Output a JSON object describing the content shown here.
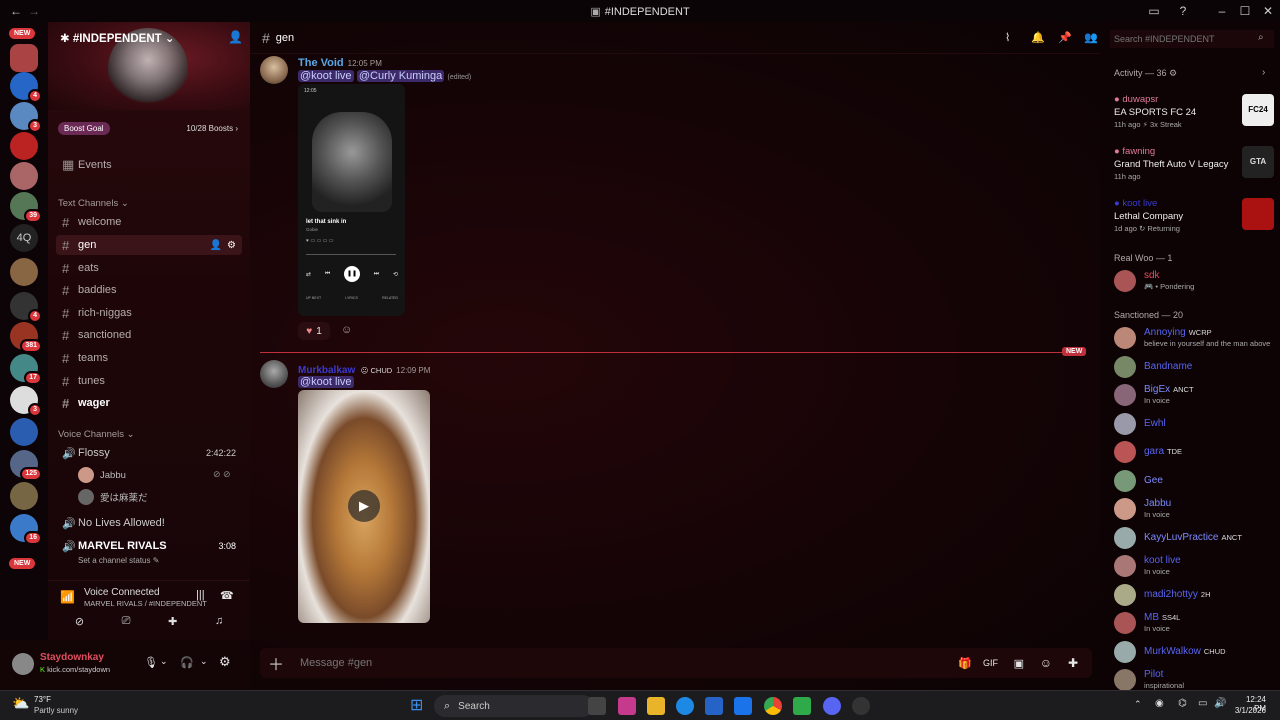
{
  "window": {
    "title": "#INDEPENDENT"
  },
  "guild_badges": [
    "NEW",
    "4",
    "3",
    "39",
    "4",
    "381",
    "17",
    "3",
    "125",
    "16",
    "NEW"
  ],
  "guild_text": "4Q",
  "server": {
    "name": "#INDEPENDENT",
    "boost_label": "Boost Goal",
    "boost_progress": "10/28 Boosts",
    "events": "Events",
    "text_category": "Text Channels",
    "channels": [
      "welcome",
      "gen",
      "eats",
      "baddies",
      "rich-niggas",
      "sanctioned",
      "teams",
      "tunes",
      "wager"
    ],
    "voice_category": "Voice Channels",
    "voice": {
      "flossy": "Flossy",
      "flossy_time": "2:42:22",
      "user1": "Jabbu",
      "user2": "愛は麻薬だ",
      "nolives": "No Lives Allowed!",
      "marvel": "MARVEL RIVALS",
      "marvel_time": "3:08",
      "marvel_status": "Set a channel status"
    }
  },
  "voicebar": {
    "status": "Voice Connected",
    "location": "MARVEL RIVALS / #INDEPENDENT"
  },
  "user": {
    "name": "Staydownkay",
    "status": "kick.com/staydown"
  },
  "channel": {
    "name": "gen"
  },
  "search": {
    "placeholder": "Search #INDEPENDENT"
  },
  "messages": [
    {
      "author": "The Void",
      "time": "12:05 PM",
      "mention1": "@koot live",
      "mention2": "@Curly Kuminga",
      "edited": "(edited)",
      "phone_song": "let that sink in",
      "phone_artist": "Gobie",
      "phone_time": "12:05",
      "phone_tabs": [
        "UP NEXT",
        "LYRICS",
        "RELATED"
      ],
      "reaction_count": "1"
    },
    {
      "author": "Murkbalkaw",
      "tag": "CHUD",
      "time": "12:09 PM",
      "mention": "@koot live"
    }
  ],
  "new_label": "NEW",
  "composer": {
    "placeholder": "Message #gen"
  },
  "activity": {
    "header": "Activity — 36",
    "items": [
      {
        "name": "duwapsr",
        "game": "EA SPORTS FC 24",
        "meta": "11h ago  ⚡ 3x Streak",
        "thumb": "FC24"
      },
      {
        "name": "fawning",
        "game": "Grand Theft Auto V Legacy",
        "meta": "11h ago",
        "thumb": "GTA"
      },
      {
        "name": "koot live",
        "game": "Lethal Company",
        "meta": "1d ago  ↻ Returning",
        "thumb": ""
      }
    ]
  },
  "sections": {
    "real": "Real Woo — 1",
    "sanctioned": "Sanctioned — 20"
  },
  "real_members": [
    {
      "name": "sdk",
      "sub": "Pondering",
      "color": "#e0505a"
    }
  ],
  "sanctioned_members": [
    {
      "name": "Annoying",
      "tag": "WCRP",
      "sub": "believe in yourself and the man above",
      "color": "#5865f2"
    },
    {
      "name": "Bandname",
      "tag": "",
      "sub": "",
      "color": "#5865f2"
    },
    {
      "name": "BigEx",
      "tag": "ANCT",
      "sub": "In voice",
      "color": "#7c8aff"
    },
    {
      "name": "Ewhl",
      "tag": "",
      "sub": "",
      "color": "#5865f2"
    },
    {
      "name": "gara",
      "tag": "TDE",
      "sub": "",
      "color": "#5865f2"
    },
    {
      "name": "Gee",
      "tag": "",
      "sub": "",
      "color": "#7c8aff"
    },
    {
      "name": "Jabbu",
      "tag": "",
      "sub": "In voice",
      "color": "#7c8aff"
    },
    {
      "name": "KayyLuvPractice",
      "tag": "ANCT",
      "sub": "",
      "color": "#7c8aff"
    },
    {
      "name": "koot live",
      "tag": "",
      "sub": "In voice",
      "color": "#5865f2"
    },
    {
      "name": "madi2hottyy",
      "tag": "2H",
      "sub": "",
      "color": "#5865f2"
    },
    {
      "name": "MB",
      "tag": "SS4L",
      "sub": "In voice",
      "color": "#5865f2"
    },
    {
      "name": "MurkWalkow",
      "tag": "CHUD",
      "sub": "",
      "color": "#5865f2"
    },
    {
      "name": "Pilot",
      "tag": "",
      "sub": "inspirational",
      "color": "#5865f2"
    }
  ],
  "taskbar": {
    "temp": "73°F",
    "weather": "Partly sunny",
    "search": "Search",
    "time": "12:24 PM",
    "date": "3/1/2026"
  }
}
